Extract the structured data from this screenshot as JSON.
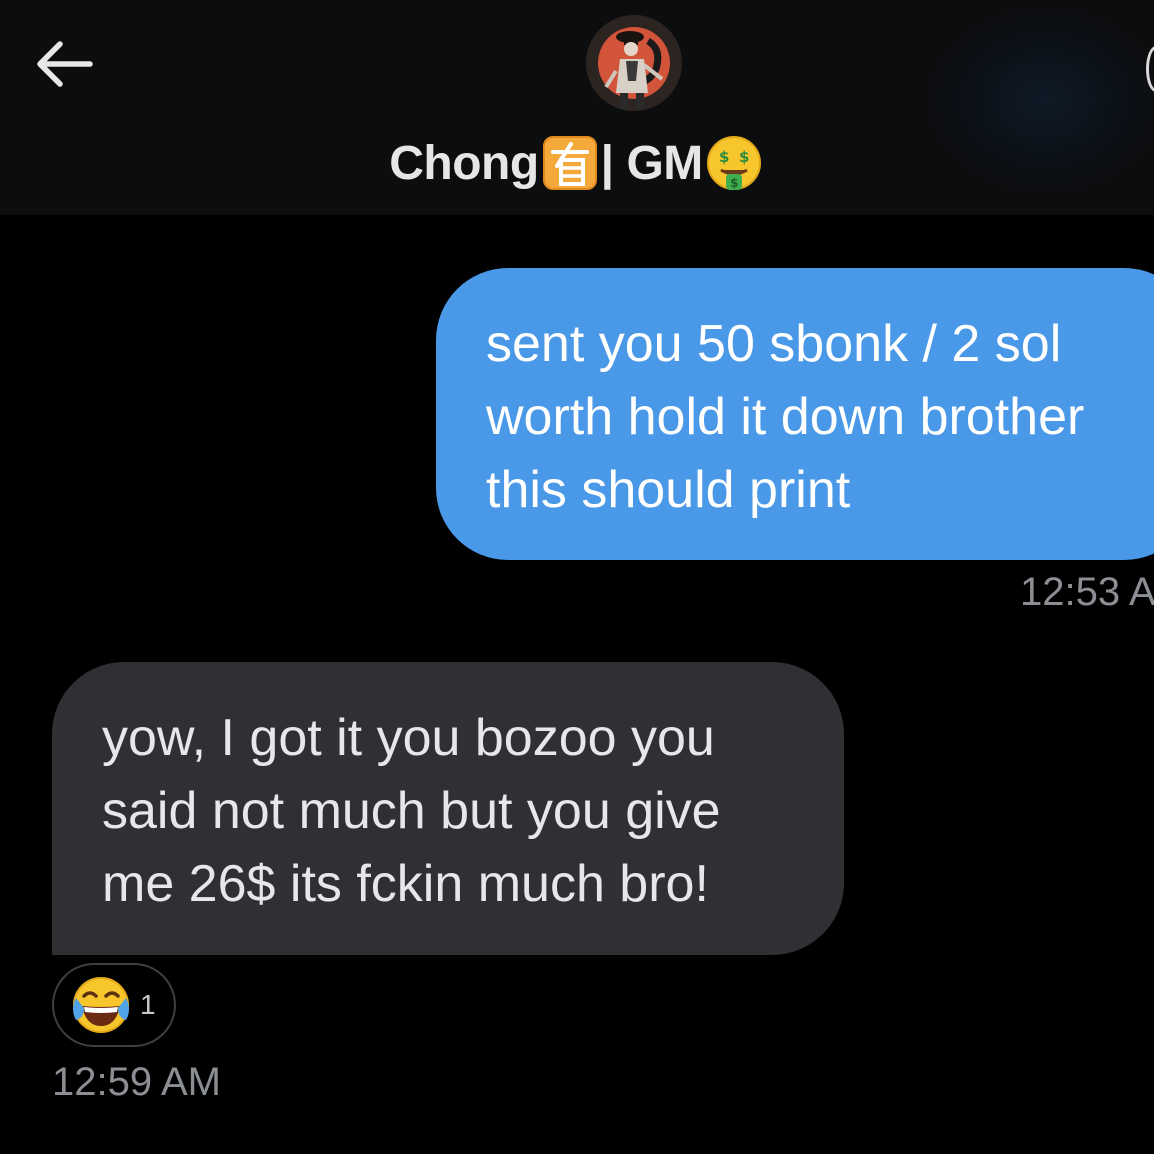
{
  "header": {
    "contact_name": "Chong",
    "contact_suffix": "| GM",
    "emoji_1": "有-square-emoji",
    "emoji_2": "money-mouth-face-emoji",
    "colors": {
      "background": "#0c0d0f",
      "title": "#e6e6e6"
    }
  },
  "messages": [
    {
      "direction": "outgoing",
      "lines": [
        "sent you 50 sbonk / 2 sol",
        "worth hold it down brother",
        "this should print"
      ],
      "time": "12:53 A",
      "bubble_color": "#4a98e8"
    },
    {
      "direction": "incoming",
      "lines": [
        "yow, I got it you bozoo you",
        "said not much but you give",
        "me 26$ its fckin much bro!"
      ],
      "time": "12:59 AM",
      "bubble_color": "#2f3034",
      "reaction": {
        "emoji": "face-with-tears-of-joy-emoji",
        "count": "1"
      }
    }
  ]
}
